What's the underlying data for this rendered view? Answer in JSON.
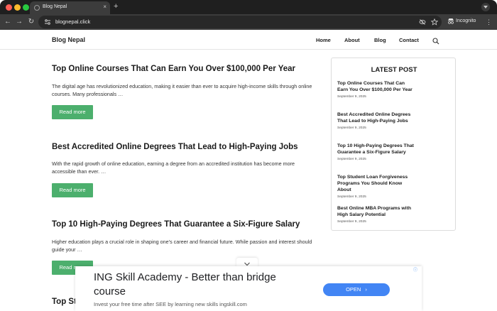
{
  "browser": {
    "tab_title": "Blog Nepal",
    "tab_close": "×",
    "new_tab": "+",
    "url": "blognepal.click",
    "incognito_label": "Incognito",
    "back": "←",
    "forward": "→",
    "reload": "↻",
    "menu": "⋮"
  },
  "site": {
    "brand": "Blog Nepal",
    "nav": [
      "Home",
      "About",
      "Blog",
      "Contact"
    ]
  },
  "posts": [
    {
      "title": "Top Online Courses That Can Earn You Over $100,000 Per Year",
      "excerpt": "The digital age has revolutionized education, making it easier than ever to acquire high-income skills through online courses. Many professionals …",
      "button": "Read more"
    },
    {
      "title": "Best Accredited Online Degrees That Lead to High-Paying Jobs",
      "excerpt": "With the rapid growth of online education, earning a degree from an accredited institution has become more accessible than ever. …",
      "button": "Read more"
    },
    {
      "title": "Top 10 High-Paying Degrees That Guarantee a Six-Figure Salary",
      "excerpt": "Higher education plays a crucial role in shaping one’s career and financial future. While passion and interest should guide your …",
      "button": "Read more"
    },
    {
      "title": "Top St"
    }
  ],
  "sidebar": {
    "title": "LATEST POST",
    "items": [
      {
        "title": "Top Online Courses That Can Earn You Over $100,000 Per Year",
        "date": "September 9, 2025"
      },
      {
        "title": "Best Accredited Online Degrees That Lead to High-Paying Jobs",
        "date": "September 9, 2025"
      },
      {
        "title": "Top 10 High-Paying Degrees That Guarantee a Six-Figure Salary",
        "date": "September 9, 2025"
      },
      {
        "title": "Top Student Loan Forgiveness Programs You Should Know About",
        "date": "September 9, 2025"
      },
      {
        "title": "Best Online MBA Programs with High Salary Potential",
        "date": "September 9, 2025"
      }
    ]
  },
  "ad": {
    "headline": "ING Skill Academy - Better than bridge course",
    "description": "Invest your free time after SEE by learning new skills ingskill.com",
    "button": "OPEN",
    "button_arrow": "›",
    "collapse": "⌄",
    "info": "ⓘ"
  },
  "colors": {
    "accent_green": "#4caf6d",
    "ad_blue": "#4285f4"
  }
}
